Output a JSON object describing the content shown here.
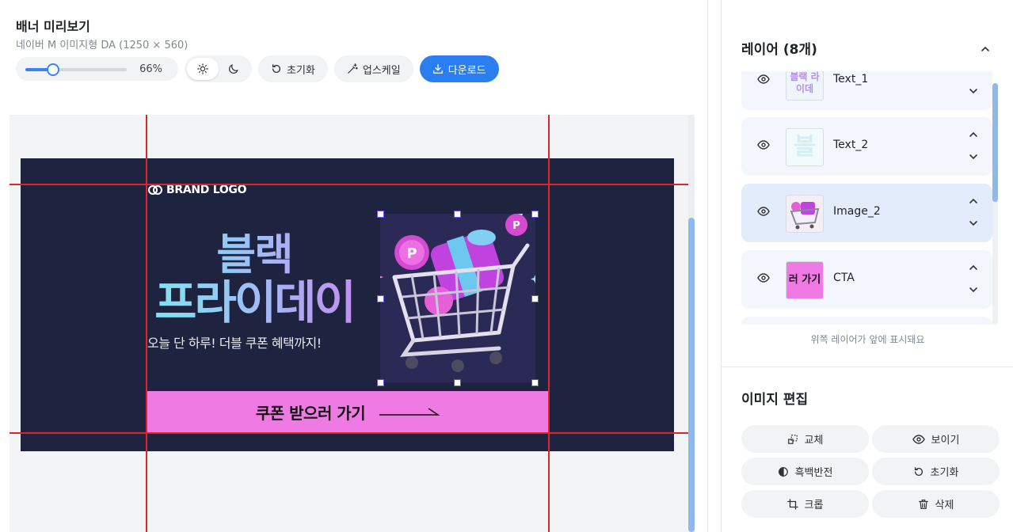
{
  "preview": {
    "title": "배너 미리보기",
    "subtitle": "네이버 M 이미지형 DA (1250 × 560)",
    "zoom": {
      "value_label": "66%",
      "level": 0.27
    },
    "theme": {
      "light_icon": "sun-icon",
      "dark_icon": "moon-icon",
      "selected": "light"
    },
    "buttons": {
      "reset": "초기화",
      "upscale": "업스케일",
      "download": "다운로드"
    },
    "colors": {
      "accent": "#2b7ef0",
      "guide": "#e0242a",
      "banner_bg": "#1e2440",
      "cta_bg": "#f07ae4"
    }
  },
  "banner": {
    "brand_logo": "BRAND LOGO",
    "headline_line1": "블랙",
    "headline_line2": "프라이데이",
    "sub_copy": "오늘 단 하루! 더블 쿠폰 혜택까지!",
    "cta": "쿠폰 받으러 가기"
  },
  "layers": {
    "title": "레이어 (8개)",
    "items": [
      {
        "name": "Text_1",
        "thumb_text": "블랙 라이데"
      },
      {
        "name": "Text_2",
        "thumb_text": "블"
      },
      {
        "name": "Image_2",
        "thumb_text": ""
      },
      {
        "name": "CTA",
        "thumb_text": "러 가기"
      }
    ],
    "note": "위쪽 레이어가 앞에 표시돼요"
  },
  "image_edit": {
    "title": "이미지 편집",
    "buttons": {
      "replace": "교체",
      "show": "보이기",
      "invert": "흑백반전",
      "reset": "초기화",
      "crop": "크롭",
      "delete": "삭제"
    }
  }
}
